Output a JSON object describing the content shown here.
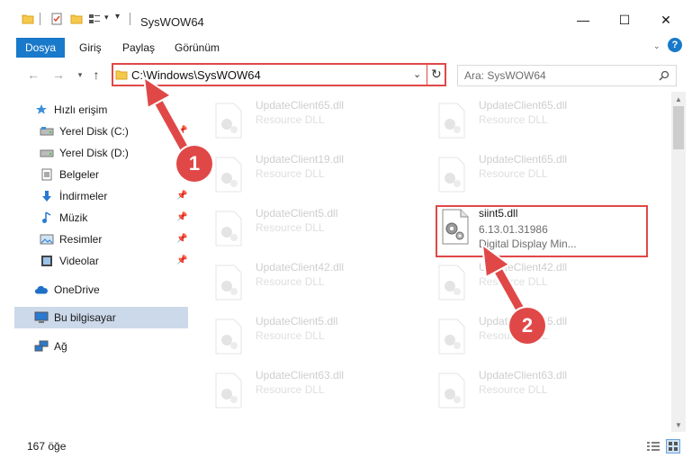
{
  "window": {
    "title": "SysWOW64",
    "minimize": "—",
    "maximize": "☐",
    "close": "✕"
  },
  "ribbon": {
    "tabs": [
      {
        "label": "Dosya",
        "active": true
      },
      {
        "label": "Giriş"
      },
      {
        "label": "Paylaş"
      },
      {
        "label": "Görünüm"
      }
    ],
    "help": "?"
  },
  "navigation": {
    "address": "C:\\Windows\\SysWOW64",
    "search_placeholder": "Ara: SysWOW64"
  },
  "sidebar": {
    "items": [
      {
        "label": "Hızlı erişim",
        "icon": "star-icon"
      },
      {
        "label": "Yerel Disk (C:)",
        "icon": "drive-icon"
      },
      {
        "label": "Yerel Disk (D:)",
        "icon": "drive-icon"
      },
      {
        "label": "Belgeler",
        "icon": "document-icon"
      },
      {
        "label": "İndirmeler",
        "icon": "download-icon"
      },
      {
        "label": "Müzik",
        "icon": "music-icon"
      },
      {
        "label": "Resimler",
        "icon": "picture-icon"
      },
      {
        "label": "Videolar",
        "icon": "video-icon"
      },
      {
        "label": "OneDrive",
        "icon": "cloud-icon"
      },
      {
        "label": "Bu bilgisayar",
        "icon": "computer-icon",
        "selected": true
      },
      {
        "label": "Ağ",
        "icon": "network-icon"
      }
    ]
  },
  "files": [
    {
      "name": "UpdateClient65.dll",
      "type": "Resource DLL"
    },
    {
      "name": "UpdateClient65.dll",
      "type": "Resource DLL"
    },
    {
      "name": "UpdateClient19.dll",
      "type": "Resource DLL"
    },
    {
      "name": "UpdateClient65.dll",
      "type": "Resource DLL"
    },
    {
      "name": "UpdateClient5.dll",
      "type": "Resource DLL"
    },
    {
      "name": "siint5.dll",
      "version": "6.13.01.31986",
      "description": "Digital Display Min..."
    },
    {
      "name": "UpdateClient42.dll",
      "type": "Resource DLL"
    },
    {
      "name": "UpdateClient42.dll",
      "type": "Resource DLL"
    },
    {
      "name": "UpdateClient5.dll",
      "type": "Resource DLL"
    },
    {
      "name": "UpdateClient65.dll",
      "type": "Resource DLL"
    },
    {
      "name": "UpdateClient63.dll",
      "type": "Resource DLL"
    },
    {
      "name": "UpdateClient63.dll",
      "type": "Resource DLL"
    }
  ],
  "annotations": {
    "step1": "1",
    "step2": "2"
  },
  "status": {
    "item_count": "167 öğe"
  },
  "colors": {
    "accent": "#1979ca",
    "highlight": "#e04848",
    "selected_bg": "#ccd9ea"
  }
}
